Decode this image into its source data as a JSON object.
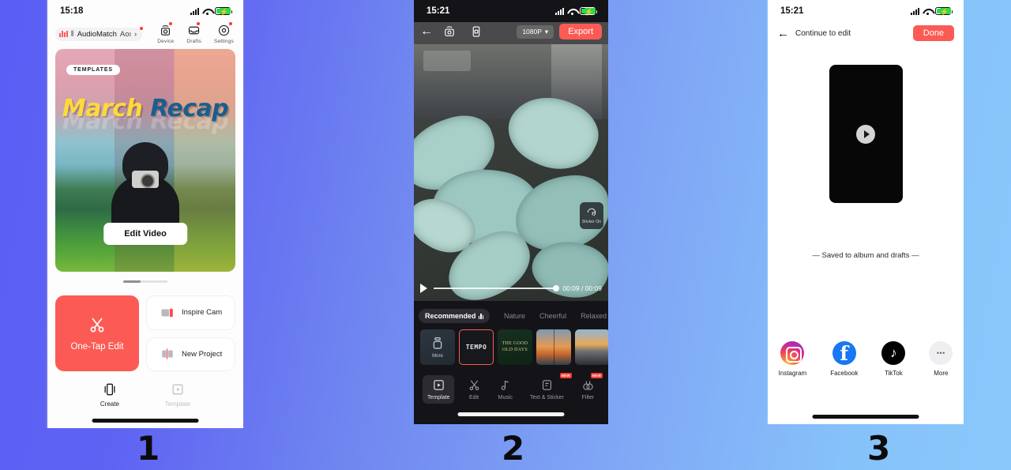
{
  "background": {
    "from": "#5a5ef5",
    "to": "#8ac8fb"
  },
  "accent": "#fb5b54",
  "steps": [
    {
      "num": "1"
    },
    {
      "num": "2"
    },
    {
      "num": "3"
    }
  ],
  "phone1": {
    "statusbar": {
      "time": "15:18"
    },
    "header": {
      "audiomatch": {
        "label": "AudioMatch",
        "sublabel": "Aoı",
        "chevron": "›"
      },
      "tools": [
        {
          "label": "Device",
          "icon": "device-camera-icon",
          "badge": true
        },
        {
          "label": "Drafts",
          "icon": "drafts-inbox-icon",
          "badge": true
        },
        {
          "label": "Settings",
          "icon": "gear-icon",
          "badge": true
        }
      ]
    },
    "hero": {
      "badge": "TEMPLATES",
      "title_part1": "March",
      "title_part2": "Recap",
      "ghost_title": "March Recap",
      "button": "Edit Video"
    },
    "actions": {
      "primary": {
        "label": "One-Tap Edit",
        "icon": "scissors-icon"
      },
      "secondary": [
        {
          "label": "Inspire Cam",
          "icon": "inspire-cam-icon"
        },
        {
          "label": "New Project",
          "icon": "new-project-icon"
        }
      ]
    },
    "nav": [
      {
        "label": "Create",
        "icon": "create-clips-icon",
        "active": true
      },
      {
        "label": "Template",
        "icon": "template-play-icon",
        "active": false
      }
    ]
  },
  "phone2": {
    "statusbar": {
      "time": "15:21"
    },
    "topbar": {
      "back": "←",
      "camera_icon": "photo-camera-icon",
      "ratio_icon": "aspect-ratio-icon",
      "resolution": "1080P",
      "resolution_caret": "▾",
      "export": "Export"
    },
    "stage": {
      "sticker_badge": "Sticker On",
      "sticker_icon": "sticker-icon",
      "time": "00:09 / 00:09",
      "play_icon": "play-icon"
    },
    "tabs": [
      {
        "label": "Recommended",
        "active": true
      },
      {
        "label": "Nature",
        "active": false
      },
      {
        "label": "Cheerful",
        "active": false
      },
      {
        "label": "Relaxed",
        "active": false
      }
    ],
    "templates": [
      {
        "type": "more",
        "label": "More",
        "icon": "more-templates-icon"
      },
      {
        "type": "tempo",
        "label": "TEMPO",
        "selected": true
      },
      {
        "type": "good",
        "label": "THE GOOD OLD DAYS"
      },
      {
        "type": "sunset",
        "label": ""
      },
      {
        "type": "road",
        "label": ""
      },
      {
        "type": "walk",
        "label": ""
      }
    ],
    "toolbar": [
      {
        "label": "Template",
        "icon": "template-icon",
        "active": true,
        "badge": ""
      },
      {
        "label": "Edit",
        "icon": "scissors-icon",
        "active": false,
        "badge": ""
      },
      {
        "label": "Music",
        "icon": "music-note-icon",
        "active": false,
        "badge": ""
      },
      {
        "label": "Text & Sticker",
        "icon": "text-sticker-icon",
        "active": false,
        "badge": "NEW"
      },
      {
        "label": "Filter",
        "icon": "filter-icon",
        "active": false,
        "badge": "NEW"
      }
    ]
  },
  "phone3": {
    "statusbar": {
      "time": "15:21"
    },
    "topbar": {
      "back": "←",
      "title": "Continue to edit",
      "done": "Done"
    },
    "player": {
      "play_icon": "play-icon"
    },
    "saved_text": "— Saved to album and drafts —",
    "share": [
      {
        "label": "Instagram",
        "icon": "instagram-icon"
      },
      {
        "label": "Facebook",
        "icon": "facebook-icon"
      },
      {
        "label": "TikTok",
        "icon": "tiktok-icon"
      },
      {
        "label": "More",
        "icon": "more-dots-icon"
      }
    ]
  }
}
